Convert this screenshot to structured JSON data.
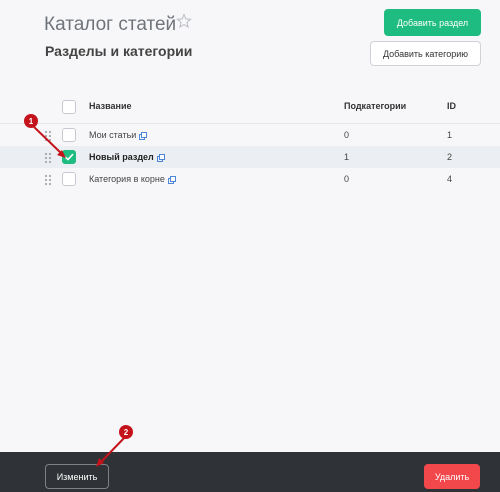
{
  "header": {
    "title": "Каталог статей",
    "subtitle": "Разделы и категории",
    "add_section_label": "Добавить раздел",
    "add_category_label": "Добавить категорию"
  },
  "table": {
    "columns": {
      "name": "Название",
      "subcategories": "Подкатегории",
      "id": "ID"
    },
    "rows": [
      {
        "name": "Мои статьи",
        "subcategories": "0",
        "id": "1",
        "checked": false,
        "bold": false
      },
      {
        "name": "Новый раздел",
        "subcategories": "1",
        "id": "2",
        "checked": true,
        "bold": true
      },
      {
        "name": "Категория в корне",
        "subcategories": "0",
        "id": "4",
        "checked": false,
        "bold": false
      }
    ]
  },
  "markers": [
    "1",
    "2"
  ],
  "footer": {
    "edit_label": "Изменить",
    "delete_label": "Удалить"
  },
  "colors": {
    "accent_green": "#1ebc81",
    "danger_red": "#f2474b",
    "marker_red": "#c4131a",
    "footer_bg": "#2f3237"
  },
  "icons": [
    "star-icon",
    "drag-handle-icon",
    "external-link-icon",
    "checkmark-icon"
  ]
}
